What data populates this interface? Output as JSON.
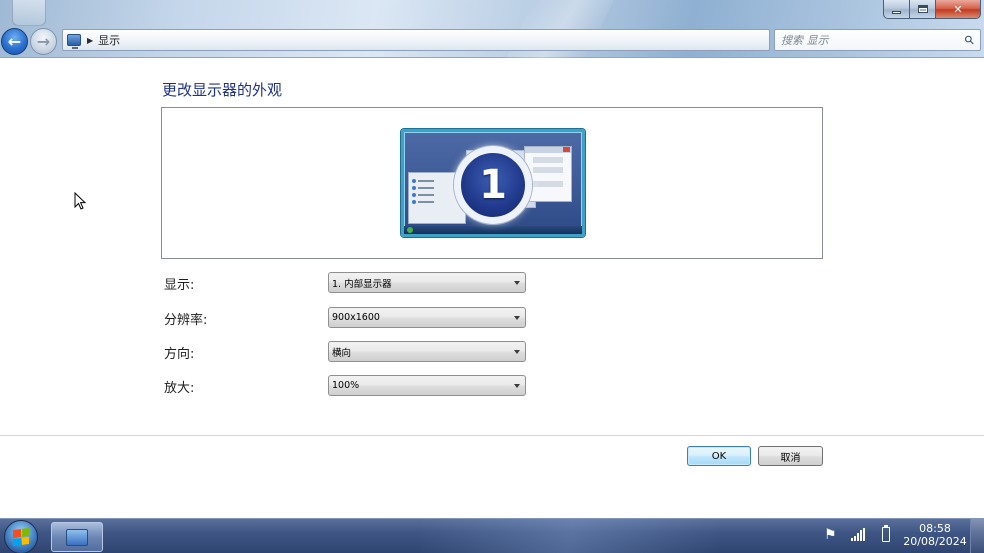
{
  "window": {
    "controls": {
      "minimize": "—",
      "maximize": "□",
      "close": "✕"
    }
  },
  "nav": {
    "back_icon": "arrow-left-icon",
    "forward_icon": "arrow-right-icon"
  },
  "address_bar": {
    "icon": "display-control-panel-icon",
    "path": "显示"
  },
  "search": {
    "placeholder": "搜索 显示",
    "icon": "search-icon"
  },
  "main": {
    "heading": "更改显示器的外观",
    "preview": {
      "monitor_number": "1"
    },
    "fields": [
      {
        "label": "显示:",
        "value": "1. 内部显示器"
      },
      {
        "label": "分辨率:",
        "value": "900x1600"
      },
      {
        "label": "方向:",
        "value": "横向"
      },
      {
        "label": "放大:",
        "value": "100%"
      }
    ]
  },
  "buttons": {
    "ok": "OK",
    "cancel": "取消"
  },
  "taskbar": {
    "start_icon": "windows-start-icon",
    "app_icon": "display-app-icon",
    "tray": {
      "flag_icon": "action-center-flag-icon",
      "signal_icon": "signal-strength-icon",
      "battery_icon": "battery-icon"
    },
    "clock": {
      "time": "08:58",
      "date": "20/08/2024"
    }
  },
  "colors": {
    "heading": "#1e3287",
    "taskbar": "#3f5685",
    "ok_button_border": "#3c7fb1"
  }
}
